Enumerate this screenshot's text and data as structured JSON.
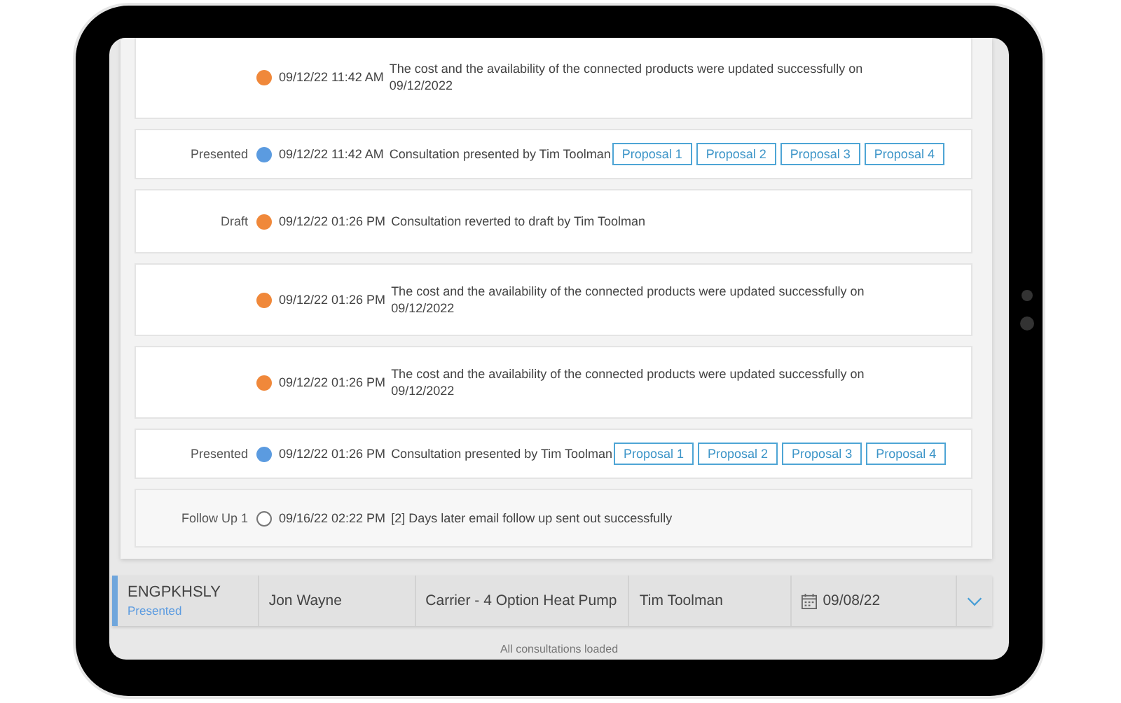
{
  "timeline": [
    {
      "color": "#f0883a",
      "kind": "dot",
      "time": "09/12/22 11:42 AM",
      "message": "The cost and the availability of the connected products were updated successfully on 09/12/2022"
    },
    {
      "label": "Presented",
      "color": "#5b9be0",
      "kind": "dot",
      "time": "09/12/22 11:42 AM",
      "message": "Consultation presented by Tim Toolman",
      "proposals": [
        "Proposal 1",
        "Proposal 2",
        "Proposal 3",
        "Proposal 4"
      ]
    },
    {
      "label": "Draft",
      "color": "#f0883a",
      "kind": "dot",
      "time": "09/12/22 01:26 PM",
      "message": "Consultation reverted to draft by Tim Toolman"
    },
    {
      "color": "#f0883a",
      "kind": "dot",
      "time": "09/12/22 01:26 PM",
      "message": "The cost and the availability of the connected products were updated successfully on 09/12/2022"
    },
    {
      "color": "#f0883a",
      "kind": "dot",
      "time": "09/12/22 01:26 PM",
      "message": "The cost and the availability of the connected products were updated successfully on 09/12/2022"
    },
    {
      "label": "Presented",
      "color": "#5b9be0",
      "kind": "dot",
      "time": "09/12/22 01:26 PM",
      "message": "Consultation presented by Tim Toolman",
      "proposals": [
        "Proposal 1",
        "Proposal 2",
        "Proposal 3",
        "Proposal 4"
      ]
    },
    {
      "label": "Follow Up 1",
      "color": "#777777",
      "kind": "ring",
      "time": "09/16/22 02:22 PM",
      "message": "[2] Days later email follow up sent out successfully"
    }
  ],
  "consultation": {
    "code": "ENGPKHSLY",
    "status": "Presented",
    "customer": "Jon Wayne",
    "product": "Carrier - 4 Option Heat Pump",
    "rep": "Tim Toolman",
    "date": "09/08/22",
    "expanded": false
  },
  "footer": "All consultations loaded"
}
